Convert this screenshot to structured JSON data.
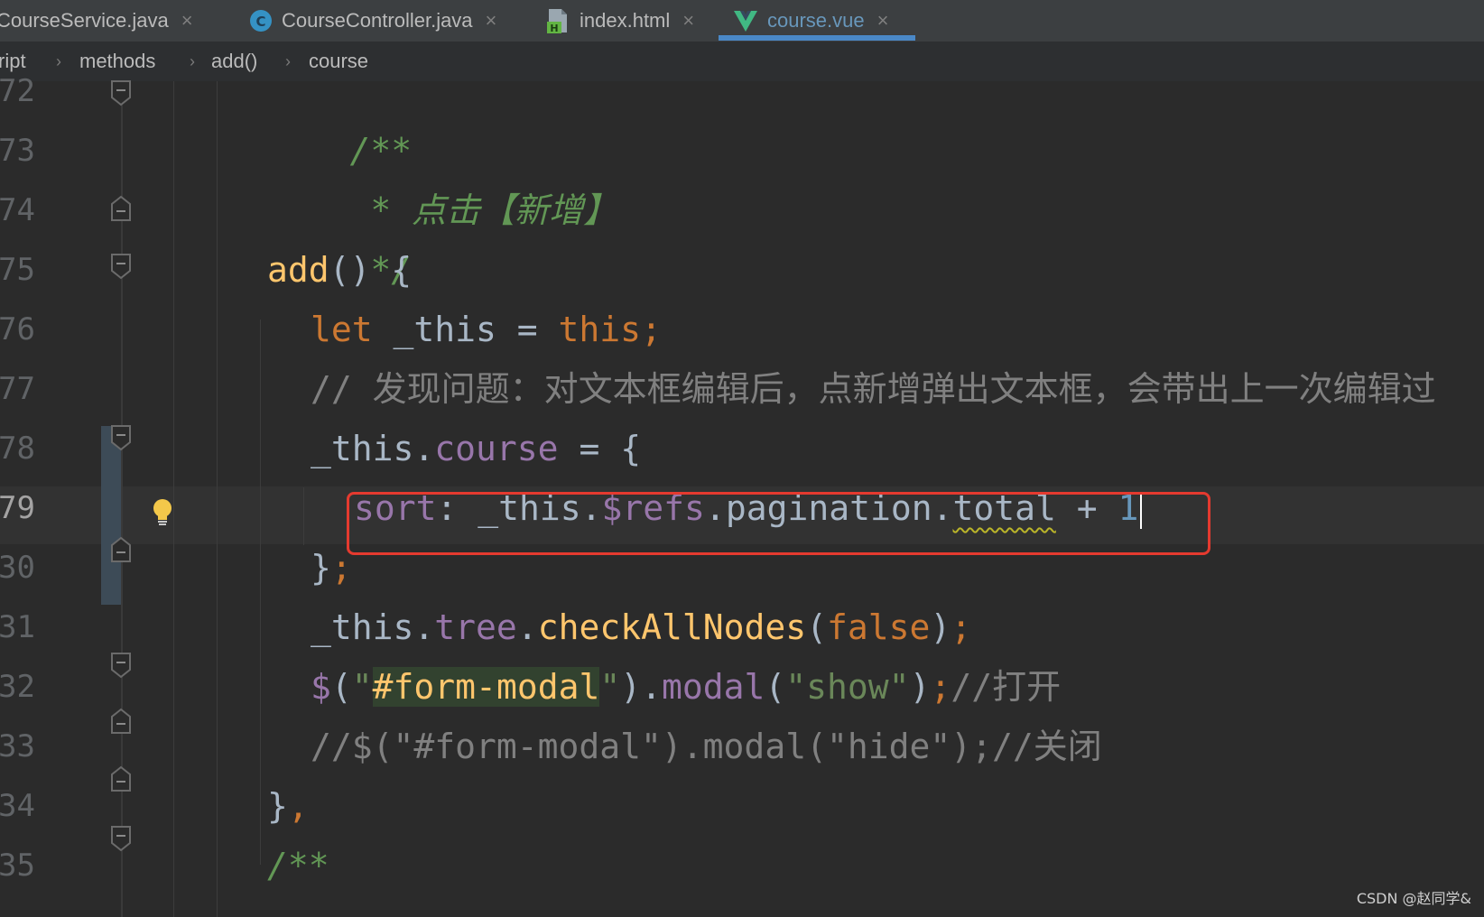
{
  "tabs": [
    {
      "label": "CourseService.java",
      "icon": "java-class-icon",
      "active": false
    },
    {
      "label": "CourseController.java",
      "icon": "java-class-icon",
      "active": false
    },
    {
      "label": "index.html",
      "icon": "html-file-icon",
      "active": false
    },
    {
      "label": "course.vue",
      "icon": "vue-file-icon",
      "active": true
    }
  ],
  "close_glyph": "×",
  "breadcrumb": [
    "ript",
    "methods",
    "add()",
    "course"
  ],
  "breadcrumb_sep": "›",
  "gutter": {
    "line_numbers": [
      "72",
      "73",
      "74",
      "75",
      "76",
      "77",
      "78",
      "79",
      "30",
      "31",
      "32",
      "33",
      "34",
      "35"
    ],
    "current_line": "79"
  },
  "code": {
    "l72": {
      "doc": "/**"
    },
    "l73": {
      "doc": " * 点击【新增】"
    },
    "l74": {
      "doc": " */"
    },
    "l75": {
      "fn": "add",
      "rest": "() {"
    },
    "l76": {
      "kw1": "let",
      "ident": " _this = ",
      "kw2": "this;"
    },
    "l77": {
      "cmt": "// 发现问题：对文本框编辑后，点新增弹出文本框，会带出上一次编辑过"
    },
    "l78": {
      "a": "_this.",
      "prop": "course",
      "b": " = {"
    },
    "l79": {
      "prop1": "sort",
      "a": ": _this.",
      "prop2": "$refs",
      "b": ".pagination.",
      "squig": "total",
      "c": " + ",
      "num": "1"
    },
    "l80": {
      "a": "}",
      "kw": ";"
    },
    "l81": {
      "a": "_this.",
      "prop": "tree",
      "b": ".",
      "fn": "checkAllNodes",
      "c": "(",
      "kw1": "false",
      "d": ")",
      "kw2": ";"
    },
    "l82": {
      "dollar": "$",
      "a": "(",
      "str1": "\"",
      "hl": "#form-modal",
      "str2": "\"",
      "b": ").",
      "prop": "modal",
      "c": "(",
      "str3": "\"show\"",
      "d": ")",
      "kw": ";",
      "cmt": "//打开"
    },
    "l83": {
      "cmt": "//$(\"#form-modal\").modal(\"hide\");//关闭"
    },
    "l84": {
      "a": "}",
      "kw": ","
    },
    "l85": {
      "doc": "/**"
    }
  },
  "watermark": "CSDN @赵同学&",
  "colors": {
    "background": "#2b2b2b",
    "keyword": "#cc7832",
    "function": "#ffc66d",
    "property": "#9876aa",
    "string": "#6a8759",
    "number": "#6897bb",
    "comment": "#808080",
    "highlight_box": "#e53a2f",
    "active_tab": "#6897bb"
  }
}
